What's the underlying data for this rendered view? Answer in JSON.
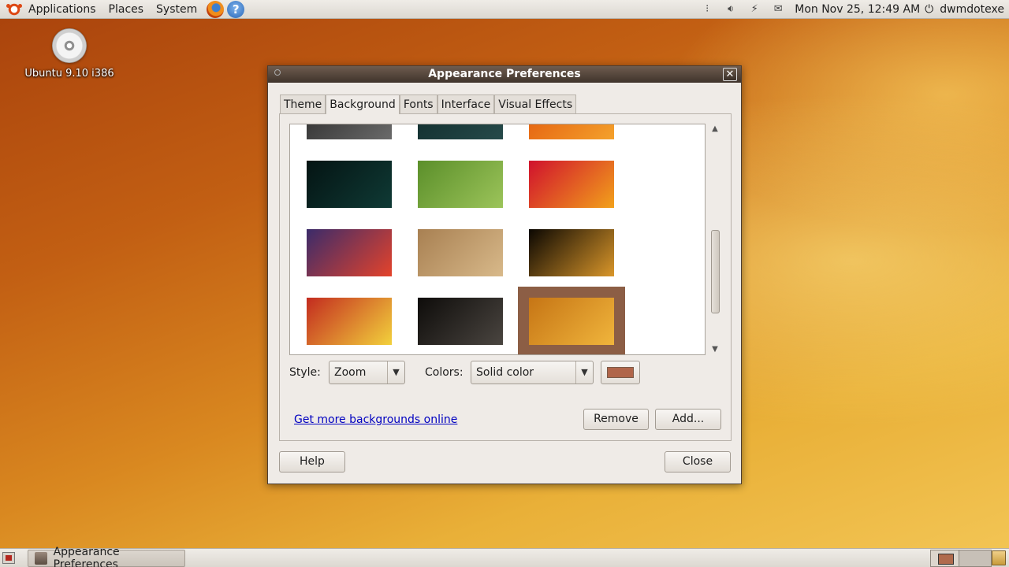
{
  "top_panel": {
    "menus": [
      "Applications",
      "Places",
      "System"
    ],
    "clock": "Mon Nov 25, 12:49 AM",
    "user": "dwmdotexe"
  },
  "desktop": {
    "icon_label": "Ubuntu 9.10 i386"
  },
  "window": {
    "title": "Appearance Preferences",
    "close_glyph": "✕",
    "tabs": [
      "Theme",
      "Background",
      "Fonts",
      "Interface",
      "Visual Effects"
    ],
    "active_tab": "Background",
    "style_label": "Style:",
    "style_value": "Zoom",
    "colors_label": "Colors:",
    "colors_value": "Solid color",
    "color_swatch": "#b0654a",
    "link_text": "Get more backgrounds online",
    "remove_label": "Remove",
    "add_label": "Add...",
    "help_label": "Help",
    "close_label": "Close"
  },
  "gallery": {
    "thumbnails": [
      {
        "name": "dark-texture",
        "colors": [
          "#2a2a2a",
          "#6a6a6a"
        ]
      },
      {
        "name": "teal-dark",
        "colors": [
          "#0f2a2a",
          "#264a4a"
        ]
      },
      {
        "name": "orange-flower-top",
        "colors": [
          "#e2560c",
          "#f4a12b"
        ]
      },
      {
        "name": "water-sparkle",
        "colors": [
          "#041413",
          "#0f3a35"
        ]
      },
      {
        "name": "green-leaf",
        "colors": [
          "#5b8f2a",
          "#9cc45a"
        ]
      },
      {
        "name": "red-flowers",
        "colors": [
          "#d0112d",
          "#f2a11b"
        ]
      },
      {
        "name": "sunset-sea",
        "colors": [
          "#3b2b6a",
          "#e4432b"
        ]
      },
      {
        "name": "sand-dunes",
        "colors": [
          "#a88052",
          "#d8b98a"
        ]
      },
      {
        "name": "dark-sunset",
        "colors": [
          "#0b0702",
          "#d9962a"
        ]
      },
      {
        "name": "paint-brushes",
        "colors": [
          "#c32b1f",
          "#f2d13c"
        ]
      },
      {
        "name": "sparkles-dark",
        "colors": [
          "#0e0c0a",
          "#4a4540"
        ]
      },
      {
        "name": "ubuntu-orange",
        "colors": [
          "#c67515",
          "#f0b53c"
        ]
      }
    ],
    "selected_index": 11
  },
  "taskbar": {
    "window_label": "Appearance Preferences"
  }
}
